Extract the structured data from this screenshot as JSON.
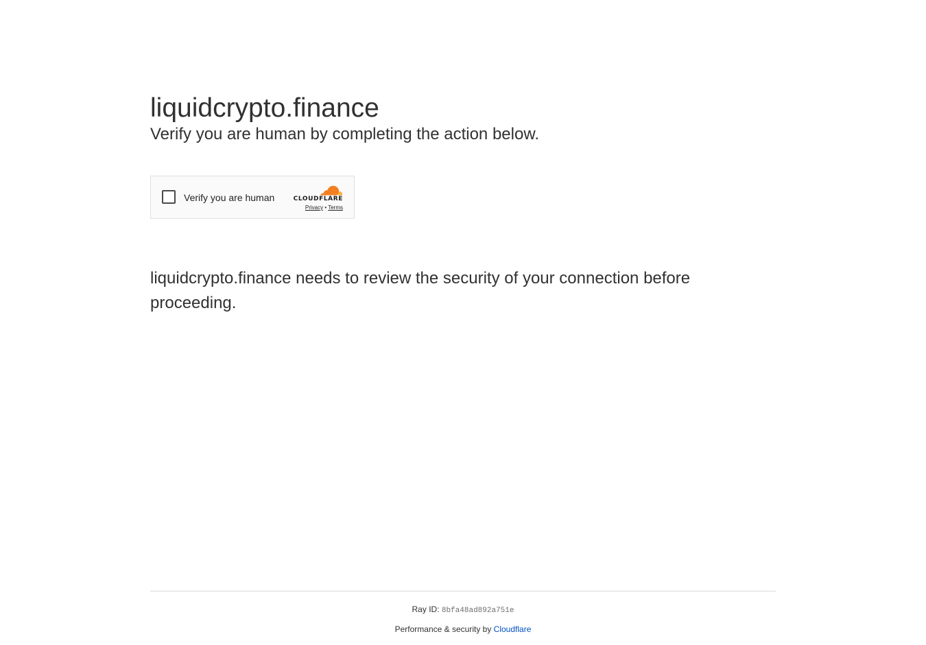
{
  "header": {
    "site_title": "liquidcrypto.finance",
    "subtitle": "Verify you are human by completing the action below."
  },
  "challenge_widget": {
    "checkbox_label": "Verify you are human",
    "brand_name": "CLOUDFLARE",
    "privacy_link": "Privacy",
    "separator": "•",
    "terms_link": "Terms",
    "checked": false
  },
  "notice": {
    "text": "liquidcrypto.finance needs to review the security of your connection before proceeding."
  },
  "footer": {
    "ray_label": "Ray ID:",
    "ray_id": "8bfa48ad892a751e",
    "performance_prefix": "Performance & security by",
    "performance_link": "Cloudflare"
  },
  "colors": {
    "text": "#313131",
    "link": "#0051c3",
    "cloud_orange": "#f38020",
    "cloud_light_orange": "#faae40"
  },
  "icons": {
    "brand_logo": "cloudflare-cloud-icon"
  }
}
